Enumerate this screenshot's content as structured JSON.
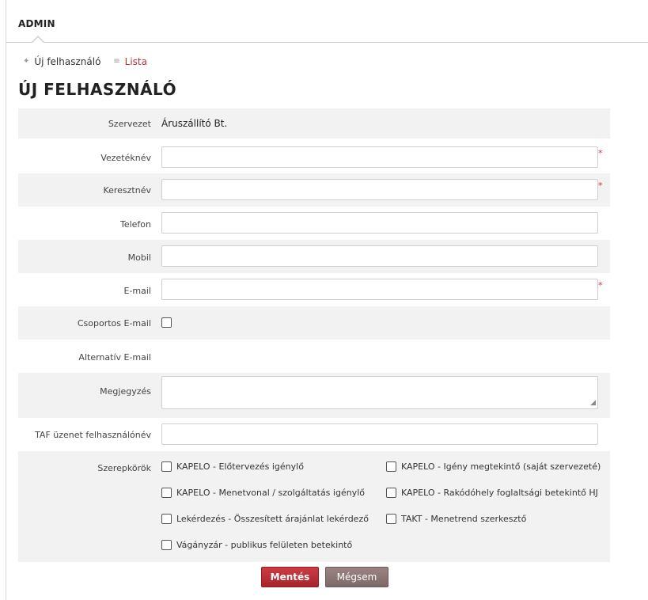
{
  "topnav": {
    "tab": "ADMIN"
  },
  "subnav": {
    "current": "Új felhasználó",
    "list_link": "Lista"
  },
  "page": {
    "title": "ÚJ FELHASZNÁLÓ"
  },
  "form": {
    "szervezet": {
      "label": "Szervezet",
      "value": "Áruszállító Bt."
    },
    "vezeteknev": {
      "label": "Vezetéknév",
      "value": "",
      "required_marker": "*"
    },
    "keresztnev": {
      "label": "Keresztnév",
      "value": "",
      "required_marker": "*"
    },
    "telefon": {
      "label": "Telefon",
      "value": ""
    },
    "mobil": {
      "label": "Mobil",
      "value": ""
    },
    "email": {
      "label": "E-mail",
      "value": "",
      "required_marker": "*"
    },
    "csoportos_email": {
      "label": "Csoportos E-mail",
      "checked": false
    },
    "alternativ_email": {
      "label": "Alternatív E-mail"
    },
    "megjegyzes": {
      "label": "Megjegyzés",
      "value": ""
    },
    "taf": {
      "label": "TAF üzenet felhasználónév",
      "value": ""
    },
    "szerepkorok": {
      "label": "Szerepkörök",
      "options": [
        {
          "label": "KAPELO - Előtervezés igénylő",
          "checked": false
        },
        {
          "label": "KAPELO - Igény megtekintő (saját szervezeté)",
          "checked": false
        },
        {
          "label": "KAPELO - Menetvonal / szolgáltatás igénylő",
          "checked": false
        },
        {
          "label": "KAPELO - Rakódóhely foglaltsági betekintő HJ",
          "checked": false
        },
        {
          "label": "Lekérdezés - Összesített árajánlat lekérdező",
          "checked": false
        },
        {
          "label": "TAKT - Menetrend szerkesztő",
          "checked": false
        },
        {
          "label": "Vágányzár - publikus felületen betekintő",
          "checked": false
        }
      ]
    }
  },
  "actions": {
    "save": "Mentés",
    "cancel": "Mégsem"
  },
  "colors": {
    "accent": "#b5323a",
    "save_button": "#b8282f",
    "cancel_button": "#8b7575",
    "row_shade": "#f2f2f2"
  }
}
